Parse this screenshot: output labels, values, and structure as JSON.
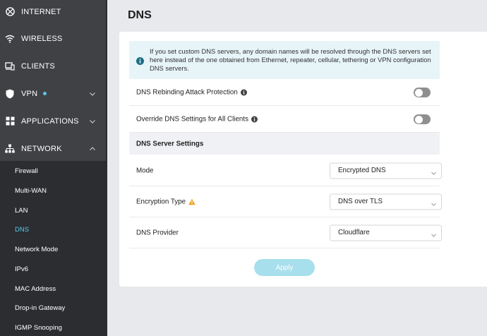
{
  "sidebar": {
    "items": [
      {
        "label": "INTERNET",
        "icon": "globe-icon"
      },
      {
        "label": "WIRELESS",
        "icon": "wifi-icon"
      },
      {
        "label": "CLIENTS",
        "icon": "devices-icon"
      },
      {
        "label": "VPN",
        "icon": "shield-icon",
        "status_dot_color": "#5ac8e8",
        "expand": "chevron-down-icon"
      },
      {
        "label": "APPLICATIONS",
        "icon": "apps-grid-icon",
        "expand": "chevron-down-icon"
      },
      {
        "label": "NETWORK",
        "icon": "network-tree-icon",
        "expand": "chevron-up-icon"
      }
    ],
    "network_submenu": [
      "Firewall",
      "Multi-WAN",
      "LAN",
      "DNS",
      "Network Mode",
      "IPv6",
      "MAC Address",
      "Drop-in Gateway",
      "IGMP Snooping"
    ],
    "active_submenu": "DNS",
    "accent_color": "#5ac8e8"
  },
  "page": {
    "title": "DNS",
    "info": "If you set custom DNS servers, any domain names will be resolved through the DNS servers set here instead of the one obtained from Ethernet, repeater, cellular, tethering or VPN configuration DNS servers.",
    "rebinding": {
      "label": "DNS Rebinding Attack Protection",
      "enabled": false,
      "icon": "info-icon"
    },
    "override": {
      "label": "Override DNS Settings for All Clients",
      "enabled": false,
      "icon": "info-icon"
    },
    "section_header": "DNS Server Settings",
    "mode": {
      "label": "Mode",
      "value": "Encrypted DNS"
    },
    "encryption": {
      "label": "Encryption Type",
      "value": "DNS over TLS",
      "icon": "warning-icon",
      "warning_color": "#f0a020"
    },
    "provider": {
      "label": "DNS Provider",
      "value": "Cloudflare"
    },
    "apply_label": "Apply",
    "apply_color": "#a7dfec"
  }
}
